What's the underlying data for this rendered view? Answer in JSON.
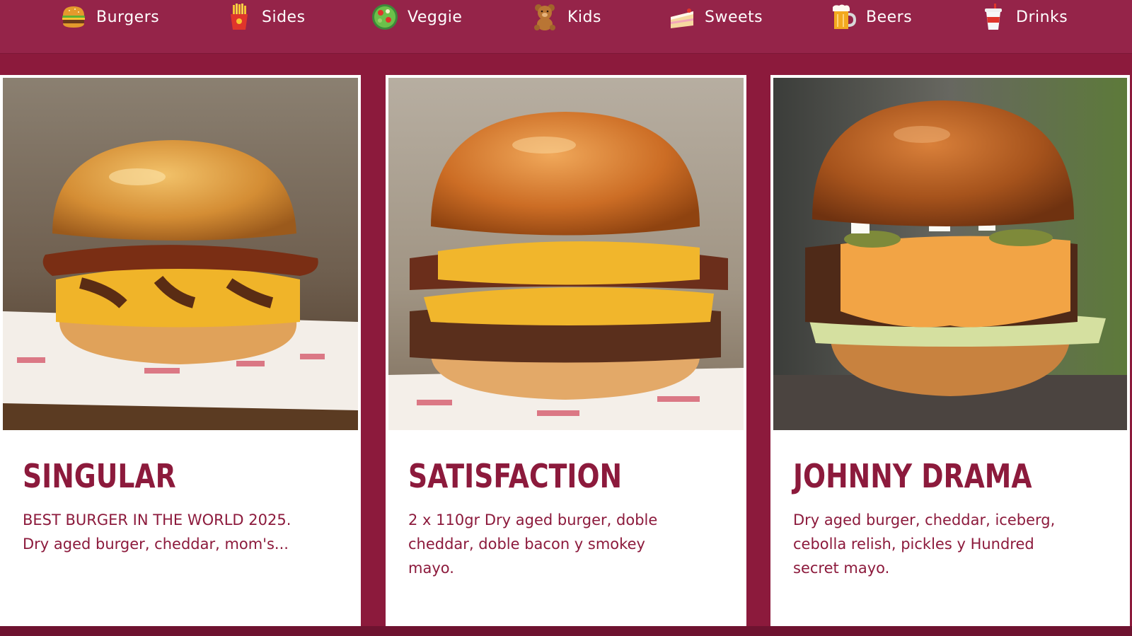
{
  "nav": {
    "items": [
      {
        "label": "Burgers",
        "icon": "burger-icon"
      },
      {
        "label": "Sides",
        "icon": "fries-icon"
      },
      {
        "label": "Veggie",
        "icon": "salad-icon"
      },
      {
        "label": "Kids",
        "icon": "teddy-bear-icon"
      },
      {
        "label": "Sweets",
        "icon": "cake-icon"
      },
      {
        "label": "Beers",
        "icon": "beer-mug-icon"
      },
      {
        "label": "Drinks",
        "icon": "soda-cup-icon"
      }
    ]
  },
  "cards": [
    {
      "title": "SINGULAR",
      "description": "BEST BURGER IN THE WORLD 2025. Dry aged burger, cheddar, mom's...",
      "image": "burger-photo-singular"
    },
    {
      "title": "SATISFACTION",
      "description": "2 x 110gr Dry aged burger, doble cheddar, doble bacon y smokey mayo.",
      "image": "burger-photo-satisfaction"
    },
    {
      "title": "JOHNNY DRAMA",
      "description": "Dry aged burger, cheddar, iceberg, cebolla relish, pickles y Hundred secret mayo.",
      "image": "burger-photo-johnny-drama"
    }
  ],
  "colors": {
    "brand": "#8c1a3c",
    "nav_bg": "#952449",
    "card_bg": "#ffffff",
    "text": "#8c1a3c"
  }
}
